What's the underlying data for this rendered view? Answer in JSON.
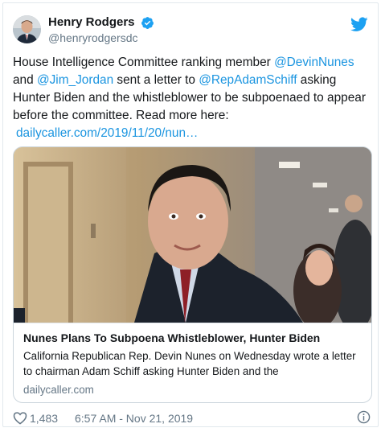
{
  "user": {
    "display_name": "Henry Rodgers",
    "handle": "@henryrodgersdc",
    "verified": true
  },
  "tweet": {
    "text_parts": {
      "t1": "House Intelligence Committee ranking member ",
      "m1": "@DevinNunes",
      "t2": " and ",
      "m2": "@Jim_Jordan",
      "t3": " sent a letter to ",
      "m3": "@RepAdamSchiff",
      "t4": " asking Hunter Biden and the whistleblower to be subpoenaed to appear before the committee. Read more here:",
      "link": "dailycaller.com/2019/11/20/nun…"
    }
  },
  "card": {
    "title": "Nunes Plans To Subpoena Whistleblower, Hunter Biden",
    "description": "California Republican Rep. Devin Nunes on Wednesday wrote a letter to chairman Adam Schiff asking Hunter Biden and the",
    "domain": "dailycaller.com"
  },
  "footer": {
    "likes": "1,483",
    "timestamp": "6:57 AM - Nov 21, 2019"
  },
  "icons": {
    "verified": "verified-badge-icon",
    "twitter": "twitter-bird-icon",
    "like": "heart-icon",
    "info": "info-icon"
  },
  "colors": {
    "link": "#1b95e0",
    "secondary_text": "#657786",
    "border": "#e1e8ed",
    "verified": "#1da1f2"
  }
}
